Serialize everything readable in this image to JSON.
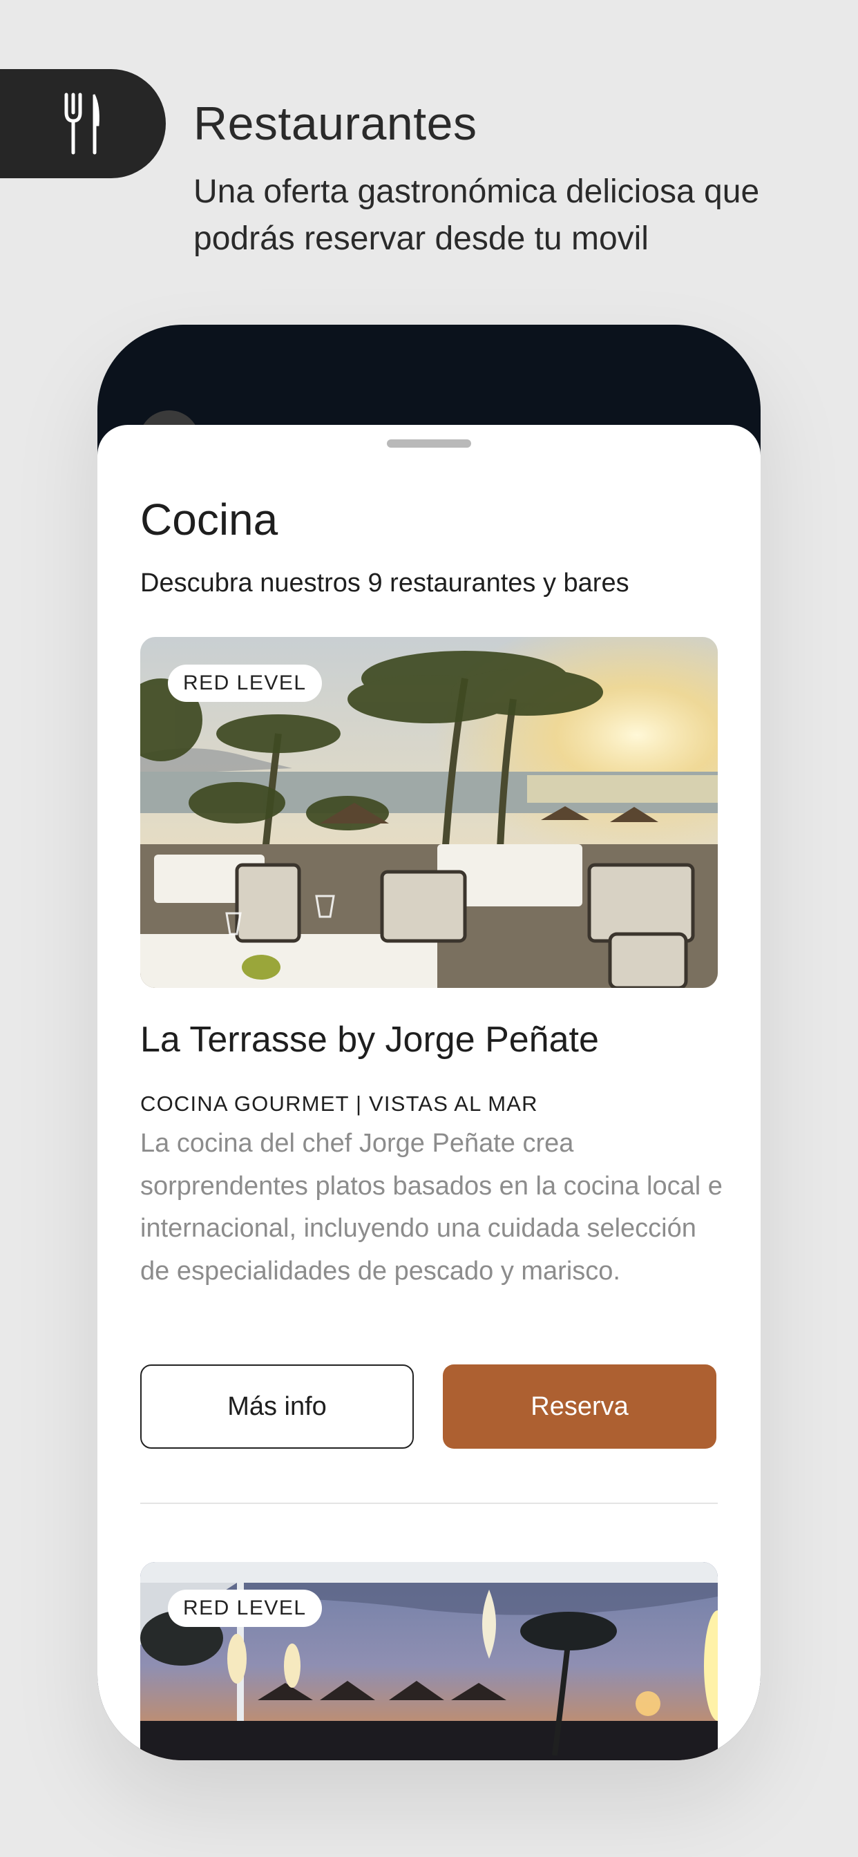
{
  "promo": {
    "icon": "cutlery-icon",
    "title": "Restaurantes",
    "subtitle": "Una oferta gastronómica deliciosa que podrás reservar desde tu movil"
  },
  "sheet": {
    "title": "Cocina",
    "subtitle": "Descubra nuestros 9 restaurantes y bares"
  },
  "cards": [
    {
      "badge": "RED LEVEL",
      "name": "La Terrasse by Jorge Peñate",
      "tags": "COCINA GOURMET | VISTAS AL MAR",
      "description": "La cocina del chef Jorge Peñate crea sorprendentes platos basados en la cocina local e internacional, incluyendo una cuidada selección de especialidades de pescado y marisco.",
      "more_info_label": "Más info",
      "book_label": "Reserva"
    },
    {
      "badge": "RED LEVEL"
    }
  ],
  "colors": {
    "accent": "#ad6031",
    "phone_frame": "#0b121c",
    "background": "#e9e9e9"
  }
}
